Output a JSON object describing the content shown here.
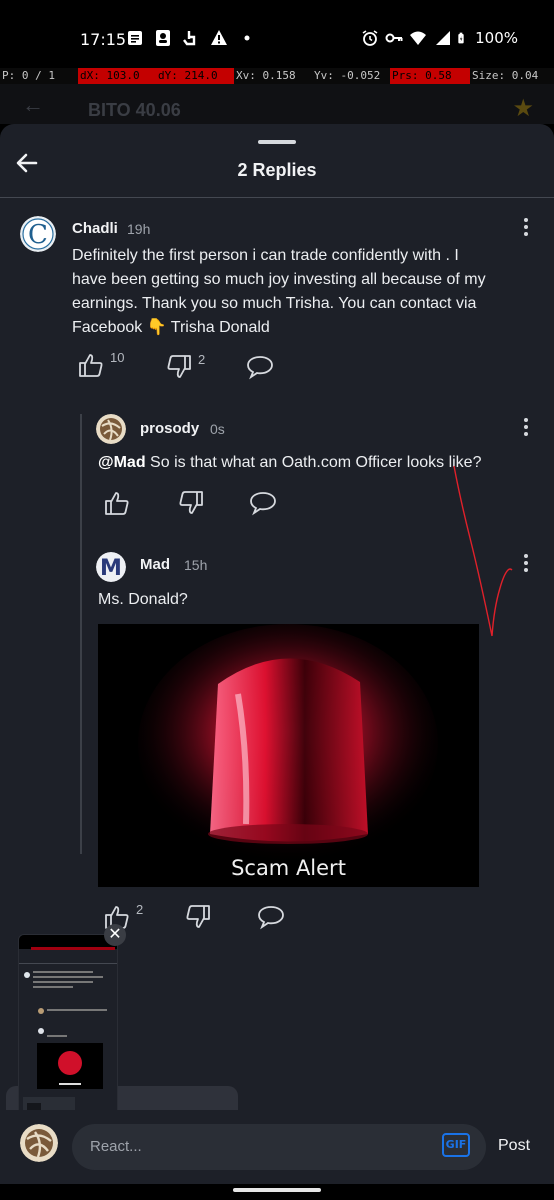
{
  "status_bar": {
    "time": "17:15",
    "battery": "100%",
    "icons": [
      "notes-icon",
      "contacts-icon",
      "hand-icon",
      "warning-icon",
      "dot-icon",
      "alarm-icon",
      "vpn-key-icon",
      "wifi-icon",
      "signal-icon",
      "battery-icon"
    ]
  },
  "debug_overlay": {
    "p": "P: 0 / 1",
    "dx": "dX: 103.0",
    "dy": "dY: 214.0",
    "xv": "Xv: 0.158",
    "yv": "Yv: -0.052",
    "prs": "Prs: 0.58",
    "size": "Size: 0.04"
  },
  "app_header": {
    "ticker": "BITO 40.06"
  },
  "sheet": {
    "title": "2 Replies"
  },
  "comments": [
    {
      "author": "Chadli",
      "time": "19h",
      "avatar_letter": "C",
      "text_lines": [
        "Definitely the first person i can trade confidently with . I",
        "have been getting so much joy investing all because of my",
        "earnings. Thank you so much Trisha. You can contact via",
        "Facebook 👇 Trisha Donald"
      ],
      "likes": "10",
      "dislikes": "2"
    },
    {
      "author": "prosody",
      "time": "0s",
      "mention": "@Mad",
      "text": " So is that what an Oath.com Officer looks like?"
    },
    {
      "author": "Mad",
      "time": "15h",
      "avatar_letter": "M",
      "text": "Ms. Donald?",
      "gif_caption": "Scam Alert",
      "likes": "2"
    }
  ],
  "input_bar": {
    "placeholder": "React...",
    "gif_label": "GIF",
    "post_label": "Post"
  },
  "colors": {
    "background": "#1d2028",
    "accent_blue": "#1a73e8",
    "alert_red": "#e01030",
    "debug_red": "#c40000"
  }
}
